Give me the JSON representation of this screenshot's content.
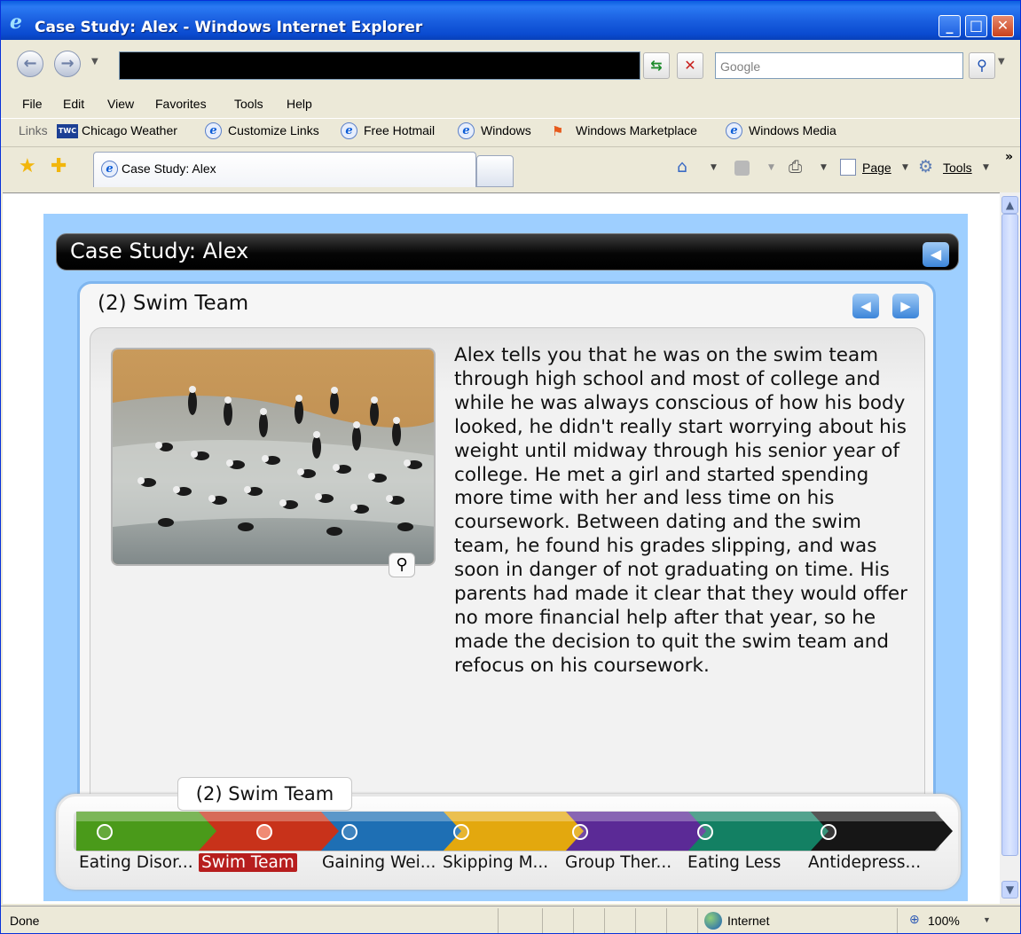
{
  "window": {
    "title": "Case Study: Alex - Windows Internet Explorer"
  },
  "toolbar": {
    "search_placeholder": "Google"
  },
  "menu": [
    "File",
    "Edit",
    "View",
    "Favorites",
    "Tools",
    "Help"
  ],
  "links": {
    "label": "Links",
    "items": [
      "Chicago Weather",
      "Customize Links",
      "Free Hotmail",
      "Windows",
      "Windows Marketplace",
      "Windows Media"
    ]
  },
  "tabs": {
    "active": "Case Study: Alex",
    "page_menu": "Page",
    "tools_menu": "Tools"
  },
  "app": {
    "title": "Case Study: Alex",
    "section_title": "(2) Swim Team",
    "body": "Alex tells you that he was on the swim team through high school and most of college and while he was always conscious of how his body looked, he didn't really start worrying about his weight until midway through his senior year of college. He met a girl and started spending more time with her and less time on his coursework. Between dating and the swim team, he found his grades slipping, and was soon in danger of not graduating on time. His parents had made it clear that they would offer no more financial help after that year, so he made the decision to quit the swim team and refocus on his coursework.",
    "tooltip": "(2) Swim Team",
    "steps": [
      {
        "label": "Eating Disor...",
        "color": "#4a9a1a"
      },
      {
        "label": "Swim Team",
        "color": "#c8321a"
      },
      {
        "label": "Gaining Wei...",
        "color": "#1e6fb4"
      },
      {
        "label": "Skipping M...",
        "color": "#e3a80e"
      },
      {
        "label": "Group Ther...",
        "color": "#5b2a96"
      },
      {
        "label": "Eating Less",
        "color": "#138063"
      },
      {
        "label": "Antidepress...",
        "color": "#161616"
      }
    ]
  },
  "status": {
    "text": "Done",
    "zone": "Internet",
    "zoom": "100%"
  }
}
